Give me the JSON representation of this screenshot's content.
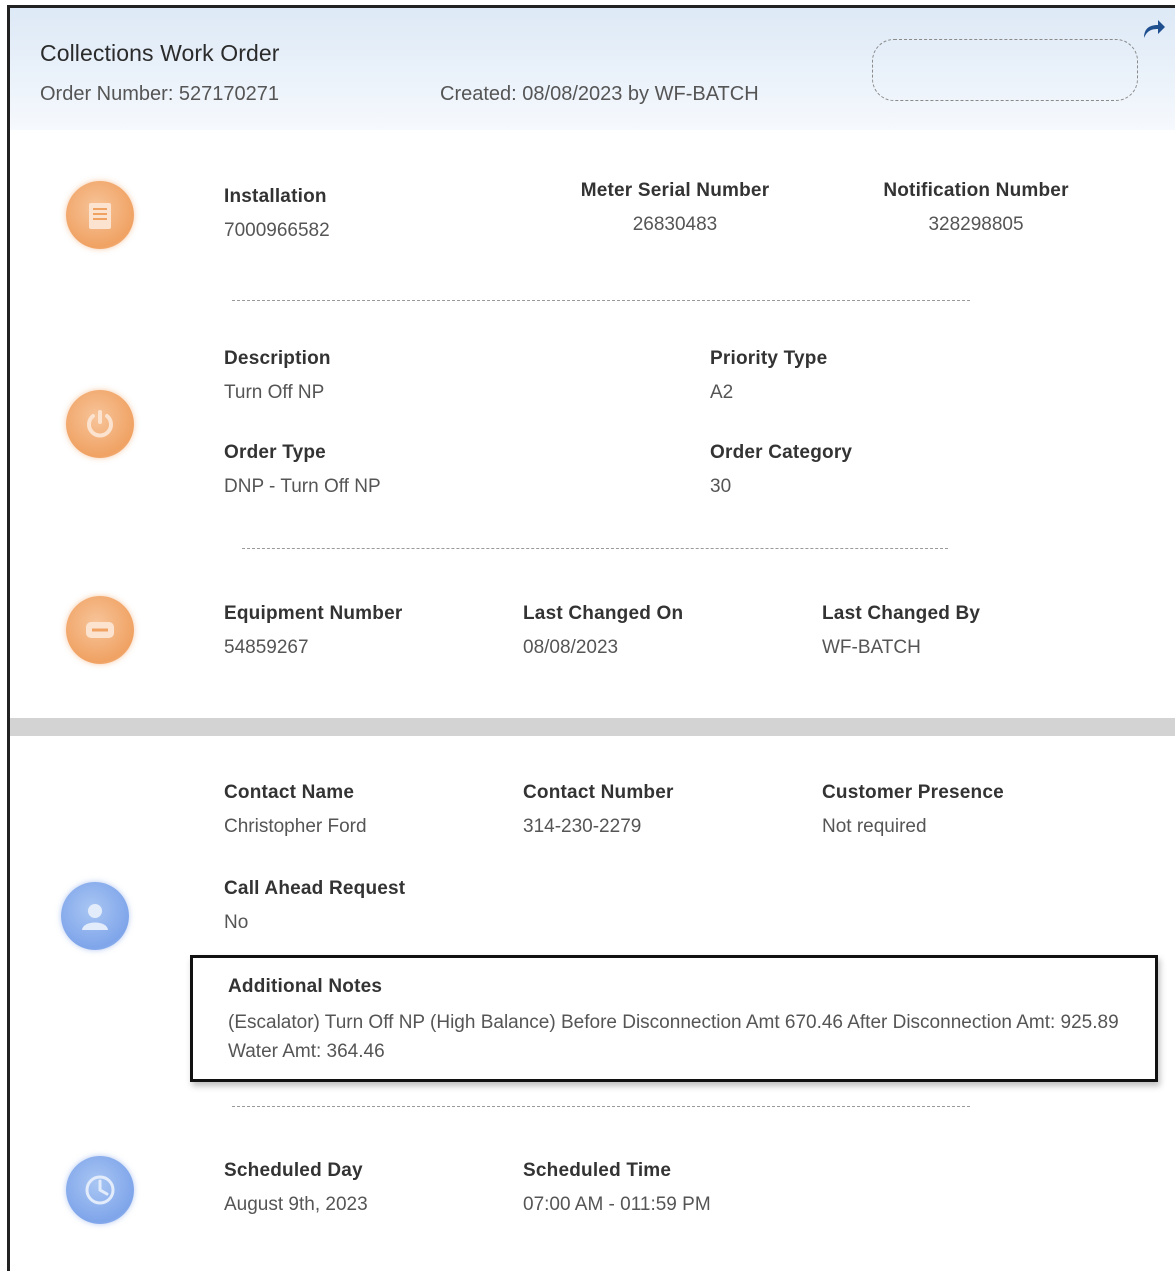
{
  "header": {
    "title": "Collections Work Order",
    "order_number": "Order Number: 527170271",
    "created": "Created: 08/08/2023 by WF-BATCH"
  },
  "section1": {
    "installation_label": "Installation",
    "installation_value": "7000966582",
    "meter_label": "Meter Serial Number",
    "meter_value": "26830483",
    "notification_label": "Notification Number",
    "notification_value": "328298805"
  },
  "section2": {
    "description_label": "Description",
    "description_value": "Turn Off NP",
    "priority_label": "Priority Type",
    "priority_value": "A2",
    "order_type_label": "Order Type",
    "order_type_value": "DNP - Turn Off NP",
    "order_category_label": "Order Category",
    "order_category_value": "30"
  },
  "section3": {
    "equipment_label": "Equipment Number",
    "equipment_value": "54859267",
    "last_changed_on_label": "Last Changed On",
    "last_changed_on_value": "08/08/2023",
    "last_changed_by_label": "Last Changed By",
    "last_changed_by_value": "WF-BATCH"
  },
  "contact": {
    "name_label": "Contact Name",
    "name_value": "Christopher Ford",
    "number_label": "Contact Number",
    "number_value": "314-230-2279",
    "presence_label": "Customer Presence",
    "presence_value": "Not required",
    "call_ahead_label": "Call Ahead Request",
    "call_ahead_value": "No",
    "notes_label": "Additional Notes",
    "notes_value": "(Escalator) Turn Off NP (High Balance) Before Disconnection Amt 670.46 After Disconnection Amt: 925.89 Water Amt: 364.46"
  },
  "schedule": {
    "day_label": "Scheduled Day",
    "day_value": "August 9th, 2023",
    "time_label": "Scheduled Time",
    "time_value": "07:00 AM - 011:59 PM"
  },
  "colors": {
    "icon_orange": "#f0a263",
    "icon_blue": "#7fa5ea",
    "header_bg": "#dde9f6"
  },
  "icons": [
    "share-icon",
    "installation-icon",
    "power-icon",
    "equipment-icon",
    "contact-icon",
    "clock-icon"
  ]
}
